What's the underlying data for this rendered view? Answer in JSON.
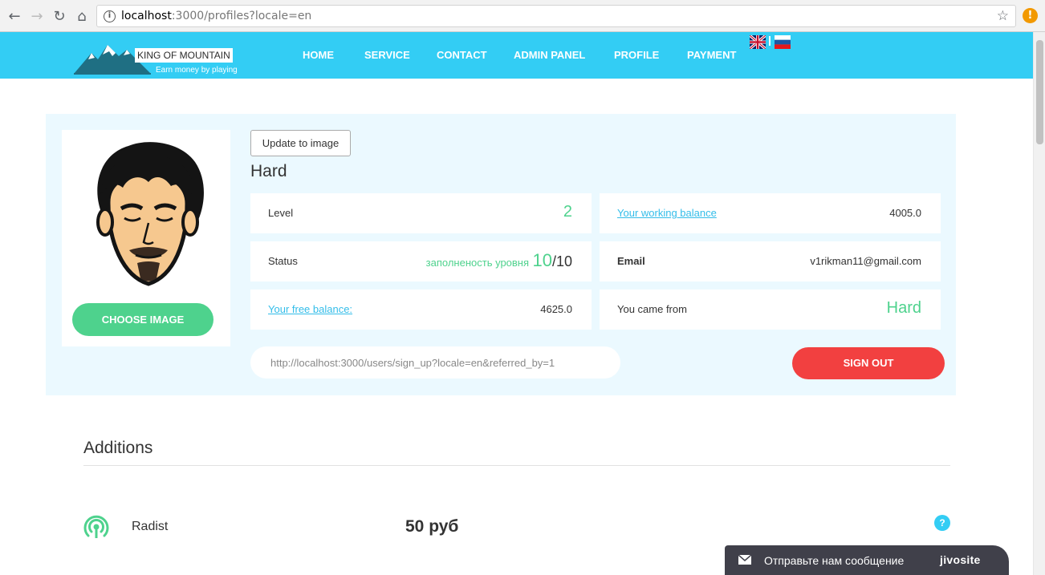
{
  "browser": {
    "url_host": "localhost",
    "url_path": ":3000/profiles?locale=en"
  },
  "header": {
    "logo_title": "KING OF MOUNTAIN",
    "logo_tagline": "Earn money by playing",
    "menu": [
      "HOME",
      "SERVICE",
      "CONTACT",
      "ADMIN PANEL",
      "PROFILE",
      "PAYMENT"
    ]
  },
  "profile": {
    "choose_image_label": "CHOOSE IMAGE",
    "update_image_label": "Update to image",
    "user_name": "Hard",
    "level_label": "Level",
    "level_value": "2",
    "working_balance_label": "Your working balance",
    "working_balance_value": "4005.0",
    "status_label": "Status",
    "status_text": "заполненость уровня",
    "status_current": "10",
    "status_total": "/10",
    "email_label": "Email",
    "email_value": "v1rikman11@gmail.com",
    "free_balance_label": "Your free balance:",
    "free_balance_value": "4625.0",
    "came_from_label": "You came from",
    "came_from_value": "Hard",
    "referral_link": "http://localhost:3000/users/sign_up?locale=en&referred_by=1",
    "sign_out_label": "SIGN OUT"
  },
  "additions": {
    "title": "Additions",
    "items": [
      {
        "name": "Radist",
        "price": "50 руб",
        "icon": "signal-icon"
      }
    ],
    "help_label": "?"
  },
  "chat": {
    "text": "Отправьте нам сообщение",
    "brand": "jivosite"
  },
  "colors": {
    "header": "#33cdf4",
    "panel": "#ebf9ff",
    "green": "#4ed28d",
    "red": "#f24040",
    "link": "#33bde9"
  }
}
